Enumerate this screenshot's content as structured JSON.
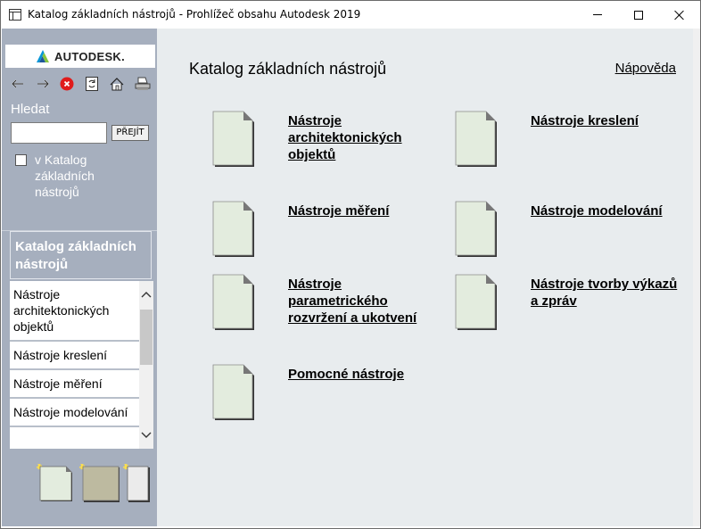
{
  "window": {
    "title": "Katalog základních nástrojů - Prohlížeč obsahu Autodesk 2019"
  },
  "sidebar": {
    "logo_text": "AUTODESK.",
    "search_label": "Hledat",
    "search_value": "",
    "go_button": "PŘEJÍT",
    "scope_label": "v Katalog základních nástrojů",
    "scope_checked": false,
    "catalog_header": "Katalog základních nástrojů",
    "toc_items": [
      "Nástroje architektonických objektů",
      "Nástroje kreslení",
      "Nástroje měření",
      "Nástroje modelování"
    ],
    "nav_icons": [
      "back-arrow-icon",
      "forward-arrow-icon",
      "stop-icon",
      "refresh-icon",
      "home-icon",
      "print-icon"
    ]
  },
  "main": {
    "title": "Katalog základních nástrojů",
    "help_link": "Nápověda",
    "tools": [
      "Nástroje architektonických objektů",
      "Nástroje kreslení",
      "Nástroje měření",
      "Nástroje modelování",
      "Nástroje parametrického rozvržení a ukotvení",
      "Nástroje tvorby výkazů a zpráv",
      "Pomocné nástroje"
    ]
  },
  "colors": {
    "sidebar_bg": "#a6afbe",
    "main_bg": "#e8ecee",
    "doc_fill": "#e3ecde",
    "logo_accent": "#0696d7"
  }
}
